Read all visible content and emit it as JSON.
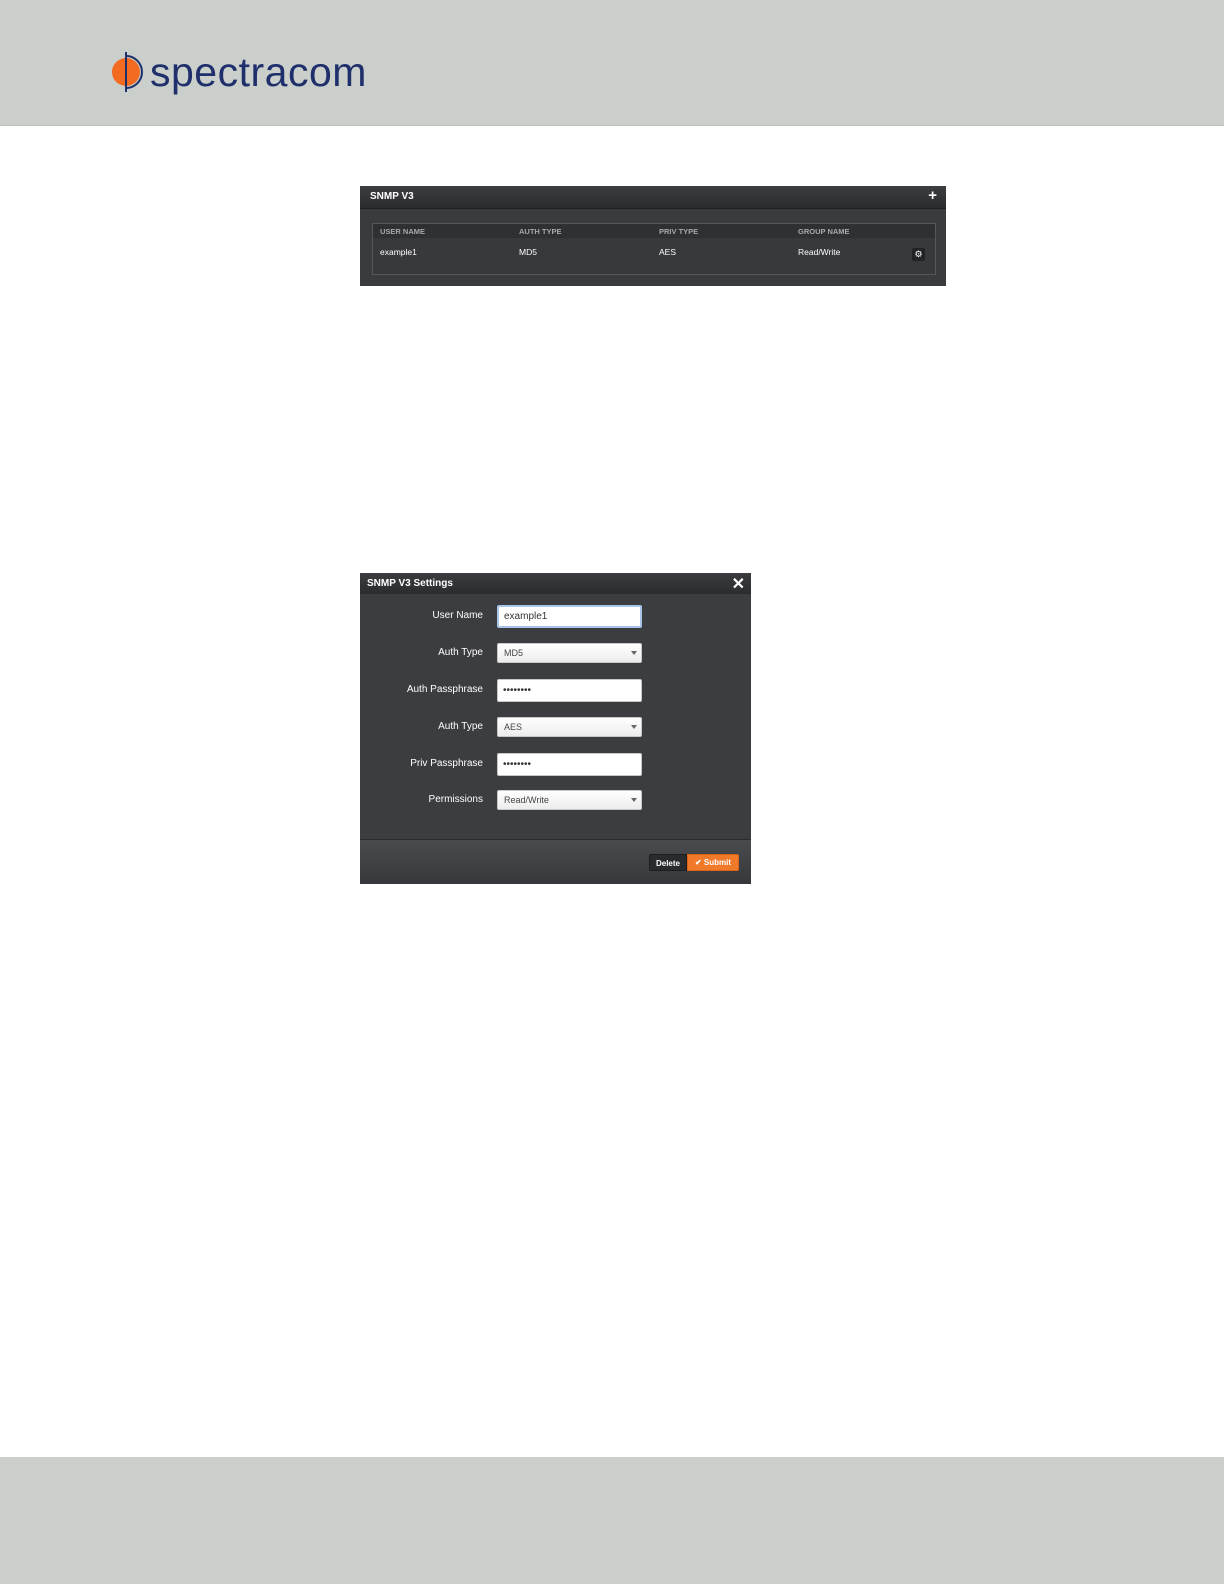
{
  "brand": {
    "name": "spectracom",
    "accent_color": "#f26b21",
    "text_color": "#1f2f6b"
  },
  "snmp_v3_panel": {
    "title": "SNMP V3",
    "add_icon": "plus-icon",
    "columns": [
      "USER NAME",
      "AUTH TYPE",
      "PRIV TYPE",
      "GROUP NAME"
    ],
    "rows": [
      {
        "user_name": "example1",
        "auth_type": "MD5",
        "priv_type": "AES",
        "group_name": "Read/Write"
      }
    ],
    "row_action_icon": "gear-icon"
  },
  "settings_dialog": {
    "title": "SNMP V3 Settings",
    "close_icon": "close-icon",
    "fields": {
      "user_name": {
        "label": "User Name",
        "value": "example1"
      },
      "auth_type": {
        "label": "Auth Type",
        "value": "MD5"
      },
      "auth_passphrase": {
        "label": "Auth Passphrase",
        "value": "••••••••"
      },
      "priv_type": {
        "label": "Auth Type",
        "value": "AES"
      },
      "priv_passphrase": {
        "label": "Priv Passphrase",
        "value": "••••••••"
      },
      "permissions": {
        "label": "Permissions",
        "value": "Read/Write"
      }
    },
    "buttons": {
      "delete": "Delete",
      "submit": "Submit"
    },
    "submit_color": "#f07a2a"
  }
}
